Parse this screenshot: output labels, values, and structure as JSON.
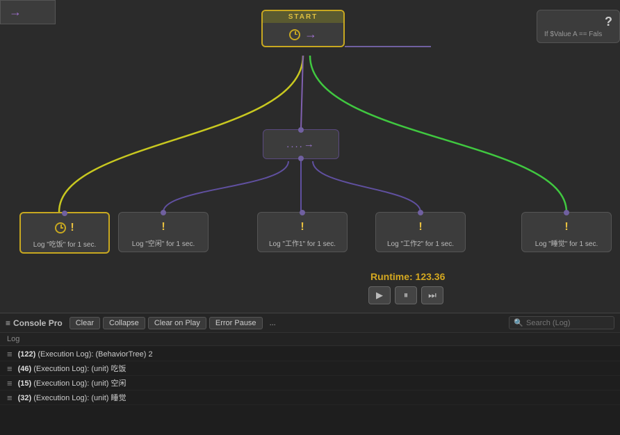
{
  "canvas": {
    "background": "#2b2b2b"
  },
  "nodes": {
    "start": {
      "label": "START",
      "icon": "clock"
    },
    "question": {
      "label": "?",
      "condition": "If $Value A == Fals"
    },
    "connector": {
      "arrow": "→"
    },
    "sequence": {
      "dots": "....→"
    },
    "log_nodes": [
      {
        "id": "log1",
        "label": "Log \"吃饭\" for 1 sec.",
        "active": true
      },
      {
        "id": "log2",
        "label": "Log \"空闲\" for 1 sec.",
        "active": false
      },
      {
        "id": "log3",
        "label": "Log \"工作1\" for 1 sec.",
        "active": false
      },
      {
        "id": "log4",
        "label": "Log \"工作2\" for 1 sec.",
        "active": false
      },
      {
        "id": "log5",
        "label": "Log \"睡觉\" for 1 sec.",
        "active": false
      }
    ]
  },
  "runtime": {
    "label": "Runtime: 123.36",
    "play": "▶",
    "pause": "⏸",
    "step": "⏭"
  },
  "console": {
    "title": "Console Pro",
    "title_icon": "≡",
    "buttons": {
      "clear": "Clear",
      "collapse": "Collapse",
      "clear_on_play": "Clear on Play",
      "error_pause": "Error Pause",
      "more": "..."
    },
    "search_placeholder": "Search (Log)",
    "log_column": "Log",
    "entries": [
      {
        "icon": "≡",
        "text": "(122) (Execution Log): (BehaviorTree) 2"
      },
      {
        "icon": "≡",
        "text": "(46) (Execution Log): (unit) 吃饭"
      },
      {
        "icon": "≡",
        "text": "(15) (Execution Log): (unit) 空闲"
      },
      {
        "icon": "≡",
        "text": "(32) (Execution Log): (unit) 睡觉"
      }
    ]
  }
}
